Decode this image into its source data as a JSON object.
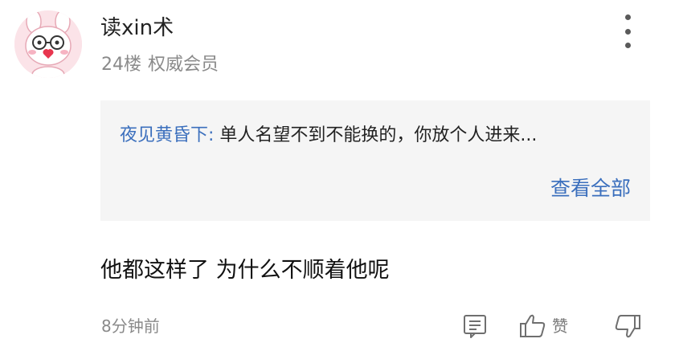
{
  "comment": {
    "username": "读xin术",
    "floor": "24楼",
    "badge": "权威会员",
    "text": "他都这样了 为什么不顺着他呢",
    "time": "8分钟前"
  },
  "reply_preview": {
    "author": "夜见黄昏下:",
    "content": "单人名望不到不能换的，你放个人进来...",
    "view_all_label": "查看全部"
  },
  "actions": {
    "reply_icon": "comment-icon",
    "like_icon": "thumbs-up-icon",
    "like_label": "赞",
    "dislike_icon": "thumbs-down-icon",
    "more_icon": "more-vertical-icon"
  },
  "colors": {
    "link_blue": "#3b6fbd",
    "meta_gray": "#8a8a8a",
    "reply_bg": "#f5f5f5",
    "avatar_pink": "#fbe3e8"
  }
}
